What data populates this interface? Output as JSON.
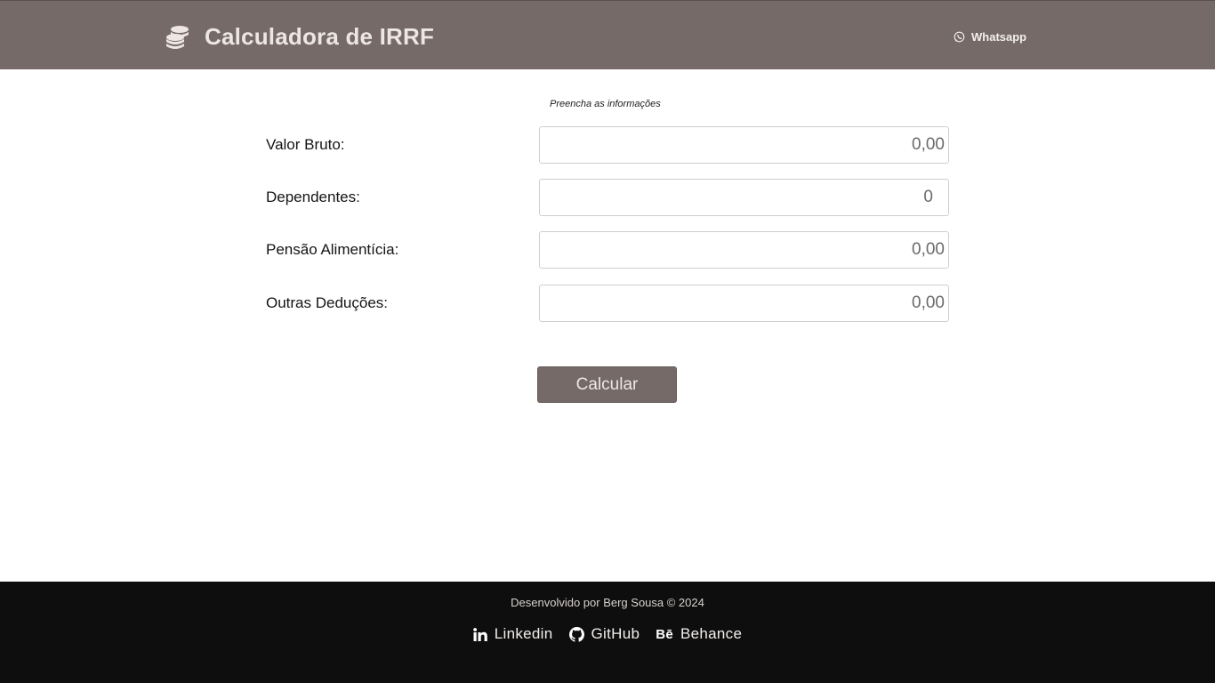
{
  "header": {
    "title": "Calculadora de IRRF",
    "whatsapp_label": "Whatsapp"
  },
  "form": {
    "hint": "Preencha as informações",
    "fields": [
      {
        "label": "Valor Bruto:",
        "value": "0,00"
      },
      {
        "label": "Dependentes:",
        "value": "0"
      },
      {
        "label": "Pensão Alimentícia:",
        "value": "0,00"
      },
      {
        "label": "Outras Deduções:",
        "value": "0,00"
      }
    ],
    "submit_label": "Calcular"
  },
  "footer": {
    "credit": "Desenvolvido por Berg Sousa © 2024",
    "links": [
      {
        "label": "Linkedin",
        "icon": "linkedin-icon"
      },
      {
        "label": "GitHub",
        "icon": "github-icon"
      },
      {
        "label": "Behance",
        "icon": "behance-icon"
      }
    ]
  },
  "colors": {
    "header_bg": "#756a67",
    "footer_bg": "#0f0e0e",
    "button_bg": "#756a67"
  }
}
